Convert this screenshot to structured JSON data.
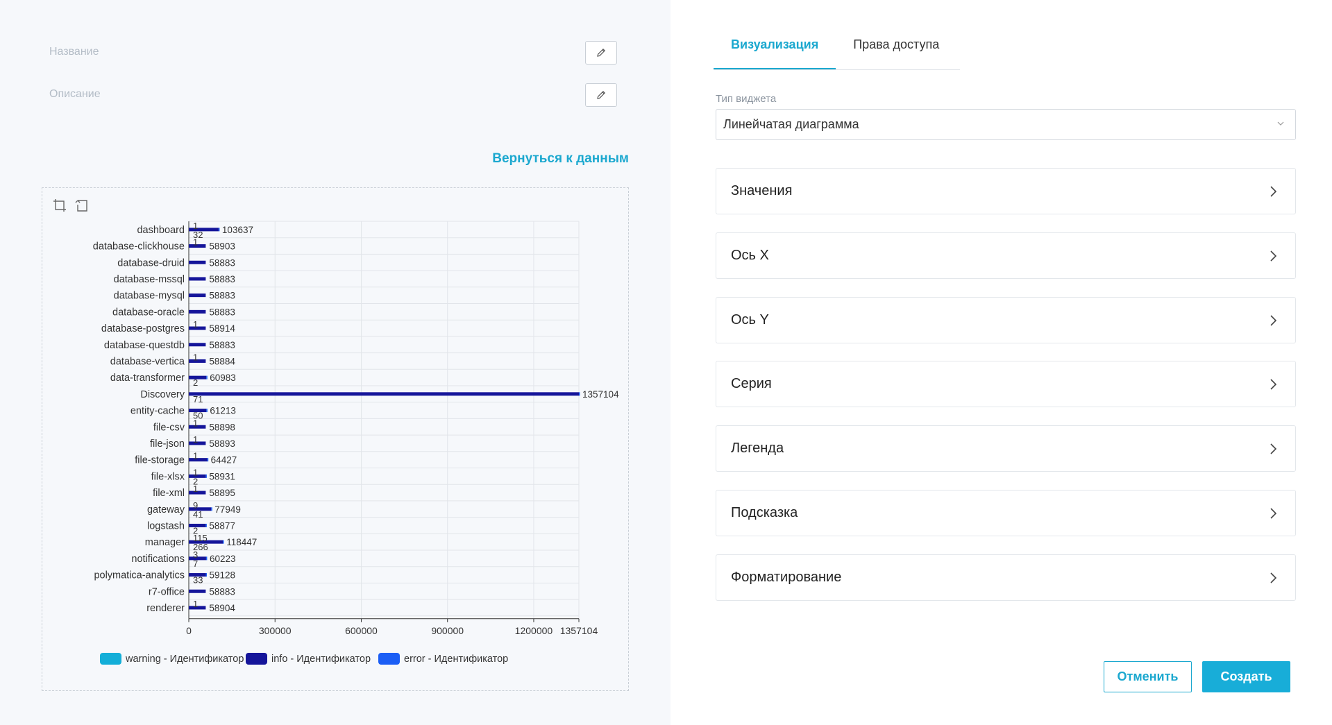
{
  "form": {
    "name_label": "Название",
    "description_label": "Описание",
    "back_link": "Вернуться к данным"
  },
  "tabs": [
    {
      "label": "Визуализация",
      "active": true
    },
    {
      "label": "Права доступа",
      "active": false
    }
  ],
  "widget": {
    "type_label": "Тип виджета",
    "type_value": "Линейчатая диаграмма"
  },
  "sections": [
    {
      "label": "Значения"
    },
    {
      "label": "Ось X"
    },
    {
      "label": "Ось Y"
    },
    {
      "label": "Серия"
    },
    {
      "label": "Легенда"
    },
    {
      "label": "Подсказка"
    },
    {
      "label": "Форматирование"
    }
  ],
  "buttons": {
    "cancel": "Отменить",
    "create": "Создать"
  },
  "colors": {
    "accent": "#1ba8cf",
    "warning": "#13aed8",
    "info": "#15159a",
    "error": "#1b5ef5"
  },
  "chart_data": {
    "type": "bar",
    "orientation": "horizontal",
    "stacked": true,
    "categories": [
      "dashboard",
      "database-clickhouse",
      "database-druid",
      "database-mssql",
      "database-mysql",
      "database-oracle",
      "database-postgres",
      "database-questdb",
      "database-vertica",
      "data-transformer",
      "Discovery",
      "entity-cache",
      "file-csv",
      "file-json",
      "file-storage",
      "file-xlsx",
      "file-xml",
      "gateway",
      "logstash",
      "manager",
      "notifications",
      "polymatica-analytics",
      "r7-office",
      "renderer"
    ],
    "series": [
      {
        "name": "warning - Идентификатор",
        "values": [
          1,
          1,
          0,
          0,
          0,
          0,
          1,
          0,
          1,
          0,
          0,
          0,
          1,
          1,
          1,
          1,
          1,
          9,
          0,
          115,
          3,
          0,
          0,
          1
        ]
      },
      {
        "name": "info - Идентификатор",
        "values": [
          103637,
          58903,
          58883,
          58883,
          58883,
          58883,
          58914,
          58883,
          58884,
          60983,
          1357104,
          61213,
          58898,
          58893,
          64427,
          58931,
          58895,
          77949,
          58877,
          118447,
          60223,
          59128,
          58883,
          58904
        ]
      },
      {
        "name": "error - Идентификатор",
        "values": [
          32,
          0,
          0,
          0,
          0,
          0,
          0,
          0,
          0,
          2,
          71,
          50,
          0,
          0,
          1,
          2,
          0,
          41,
          2,
          266,
          7,
          33,
          0,
          0
        ]
      }
    ],
    "label_texts": {
      "warning": [
        "1",
        "1",
        "",
        "",
        "",
        "",
        "1",
        "",
        "1",
        "",
        "",
        "",
        "1",
        "1",
        "1",
        "1",
        "1",
        "9",
        "",
        "115",
        "3",
        "",
        "",
        "1"
      ],
      "info": [
        "103637",
        "58903",
        "58883",
        "58883",
        "58883",
        "58883",
        "58914",
        "58883",
        "58884",
        "60983",
        "1357104",
        "61213",
        "58898",
        "58893",
        "64427",
        "58931",
        "58895",
        "77949",
        "58877",
        "118447",
        "60223",
        "59128",
        "58883",
        "58904"
      ],
      "error": [
        "32",
        "",
        "",
        "",
        "",
        "",
        "",
        "",
        "",
        "2",
        "71",
        "50",
        "",
        "",
        "",
        "2",
        "",
        "41",
        "2",
        "266",
        "7",
        "33",
        "",
        ""
      ]
    },
    "x_ticks": [
      "0",
      "300000",
      "600000",
      "900000",
      "1200000",
      "1357104"
    ],
    "x_tick_values": [
      0,
      300000,
      600000,
      900000,
      1200000,
      1357104
    ],
    "xlim": [
      0,
      1357104
    ],
    "grid": true,
    "legend_position": "bottom"
  }
}
